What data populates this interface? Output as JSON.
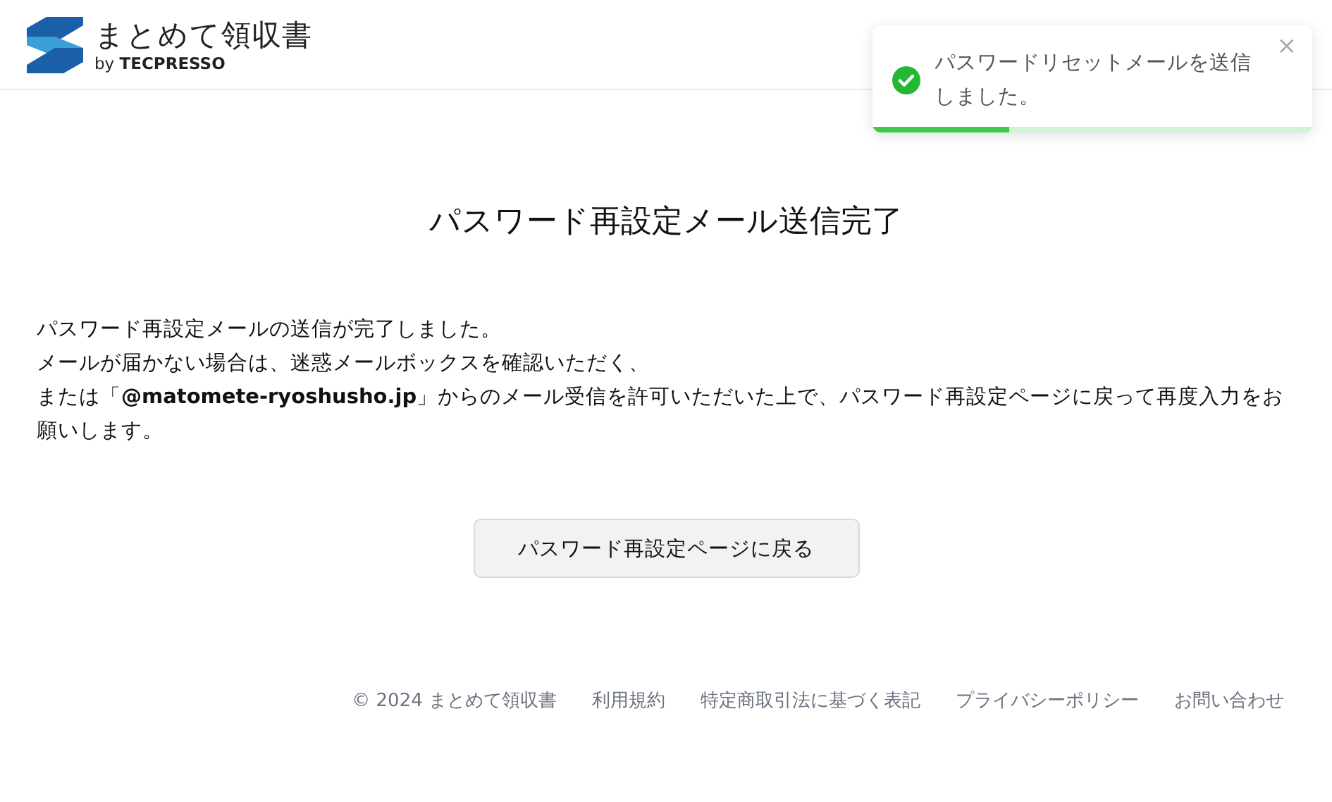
{
  "header": {
    "brand_name": "まとめて領収書",
    "byline": "by **TECPRESSO**"
  },
  "toast": {
    "kind": "success",
    "message": "パスワードリセットメールを送信しました。",
    "close": "×",
    "level": 0.31
  },
  "title": "パスワード再設定メール送信完了",
  "paragraph_lines": [
    "パスワード再設定メールの送信が完了しました。",
    "メールが届かない場合は、迷惑メールボックスを確認いただく、",
    "または「**@matomete-ryoshusho.jp**」からのメール受信を許可いただいた上で、パスワード再設定ページに戻って再度入力をお願いします。"
  ],
  "button": "パスワード再設定ページに戻る",
  "footer": {
    "copyright": "© 2024 まとめて領収書",
    "links": [
      "利用規約",
      "特定商取引法に基づく表記",
      "プライバシーポリシー",
      "お問い合わせ"
    ]
  }
}
